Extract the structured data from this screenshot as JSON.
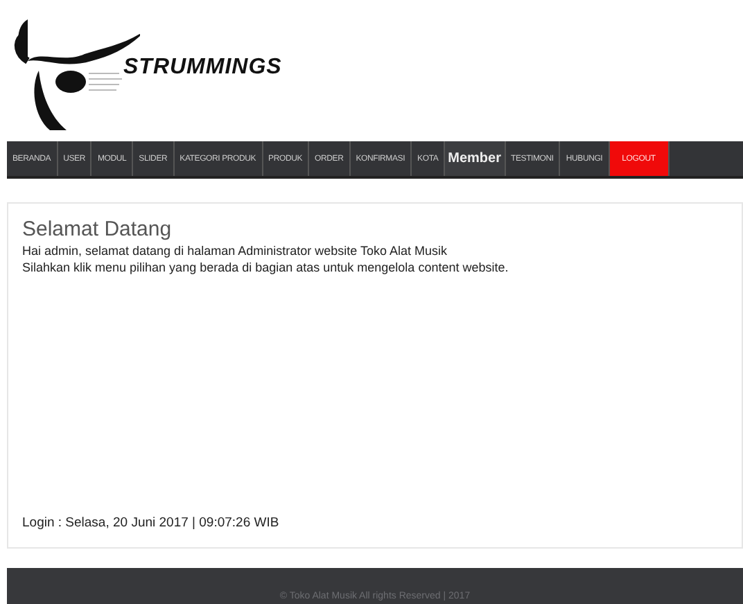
{
  "logo": {
    "text": "STRUMMINGS"
  },
  "nav": [
    {
      "label": "BERANDA",
      "kind": "link",
      "selected": false
    },
    {
      "label": "USER",
      "kind": "link",
      "selected": false
    },
    {
      "label": "MODUL",
      "kind": "link",
      "selected": false
    },
    {
      "label": "SLIDER",
      "kind": "link",
      "selected": false
    },
    {
      "label": "KATEGORI PRODUK",
      "kind": "link",
      "selected": false
    },
    {
      "label": "PRODUK",
      "kind": "link",
      "selected": false
    },
    {
      "label": "ORDER",
      "kind": "link",
      "selected": false
    },
    {
      "label": "KONFIRMASI",
      "kind": "link",
      "selected": false
    },
    {
      "label": "KOTA",
      "kind": "link",
      "selected": false
    },
    {
      "label": "Member",
      "kind": "link",
      "selected": true
    },
    {
      "label": "TESTIMONI",
      "kind": "link",
      "selected": false
    },
    {
      "label": "HUBUNGI",
      "kind": "link",
      "selected": false
    },
    {
      "label": "LOGOUT",
      "kind": "logout",
      "selected": false
    }
  ],
  "content": {
    "heading": "Selamat Datang",
    "lines": [
      "Hai admin, selamat datang di halaman Administrator website Toko Alat Musik",
      "Silahkan klik menu pilihan yang berada di bagian atas untuk mengelola content website."
    ],
    "login": "Login : Selasa, 20 Juni 2017 | 09:07:26 WIB"
  },
  "footer": "© Toko Alat Musik All rights Reserved | 2017"
}
